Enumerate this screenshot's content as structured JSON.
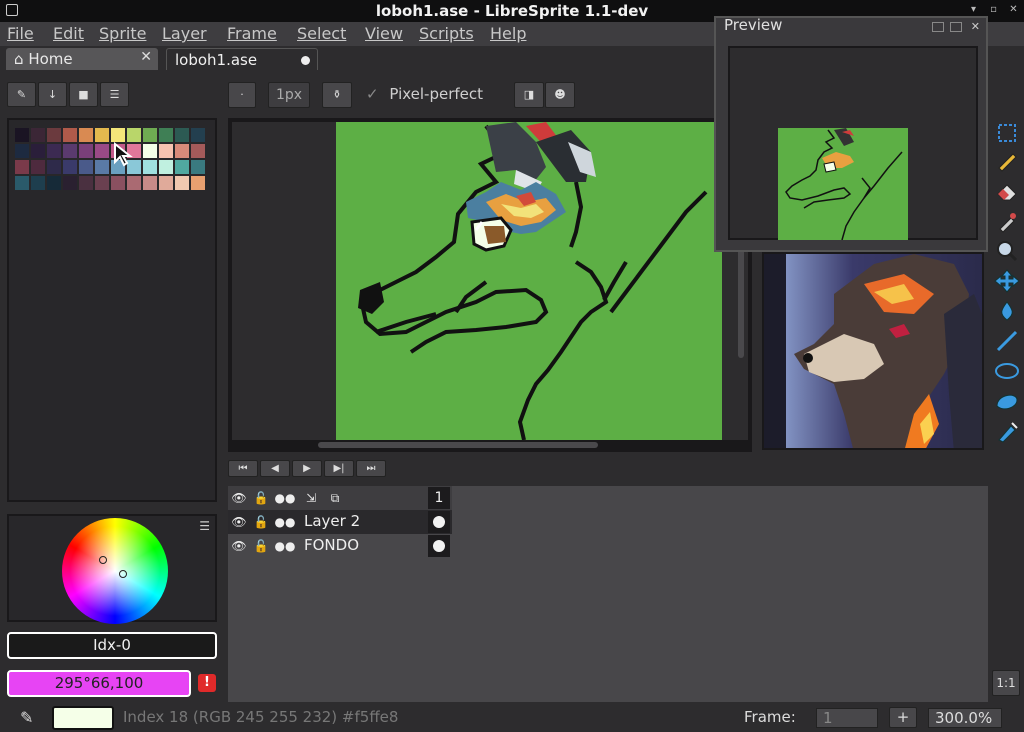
{
  "window": {
    "title": "loboh1.ase - LibreSprite 1.1-dev"
  },
  "menu": {
    "items": [
      {
        "label": "File"
      },
      {
        "label": "Edit"
      },
      {
        "label": "Sprite"
      },
      {
        "label": "Layer"
      },
      {
        "label": "Frame"
      },
      {
        "label": "Select"
      },
      {
        "label": "View"
      },
      {
        "label": "Scripts"
      },
      {
        "label": "Help"
      }
    ]
  },
  "tabs": [
    {
      "label": "Home",
      "close": "✕"
    },
    {
      "label": "loboh1.ase"
    }
  ],
  "context_bar": {
    "brush_size": "1px",
    "pixel_perfect_label": "Pixel-perfect",
    "pixel_perfect_checked": true
  },
  "palette": {
    "swatches": [
      "#1a1423",
      "#3b2636",
      "#6b3a3e",
      "#b05a4a",
      "#d98a52",
      "#e3b94e",
      "#f4e67a",
      "#b9d66a",
      "#6fab52",
      "#3f7f55",
      "#2c5a53",
      "#233f4f",
      "#1d2a40",
      "#2a1e3a",
      "#3c2a52",
      "#5a3a6e",
      "#7a3f7a",
      "#9a4a86",
      "#c25a8a",
      "#e0779a",
      "#f5ffe8",
      "#f6c2b0",
      "#d88a7a",
      "#a45a5a",
      "#7a3a4a",
      "#4e2a3e",
      "#2e2a4a",
      "#3a3a6a",
      "#4a5a8a",
      "#5a7aa6",
      "#6aa0c0",
      "#8ac8d8",
      "#a0e0e0",
      "#c0f0e0",
      "#50a8a0",
      "#3a7a80",
      "#2a5a6a",
      "#1e3e4e",
      "#162a38",
      "#2a2030",
      "#4a3040",
      "#6a4050",
      "#8a5060",
      "#aa6a72",
      "#c88a88",
      "#e0aa9a",
      "#f0c8b0",
      "#e8a070"
    ]
  },
  "color_bar": {
    "index_label": "Idx-0",
    "hsv_label": "295°66,100",
    "warning": "!"
  },
  "preview": {
    "title": "Preview"
  },
  "timeline": {
    "frame_number": "1",
    "layers": [
      {
        "name": "Layer 2"
      },
      {
        "name": "FONDO"
      }
    ]
  },
  "status": {
    "color_info": "Index 18 (RGB 245 255 232) #f5ffe8",
    "fg_color": "#f5ffe8",
    "frame_label": "Frame:",
    "frame_value": "1",
    "add_frame": "+",
    "zoom": "300.0%",
    "zoom_reset": "1:1"
  }
}
